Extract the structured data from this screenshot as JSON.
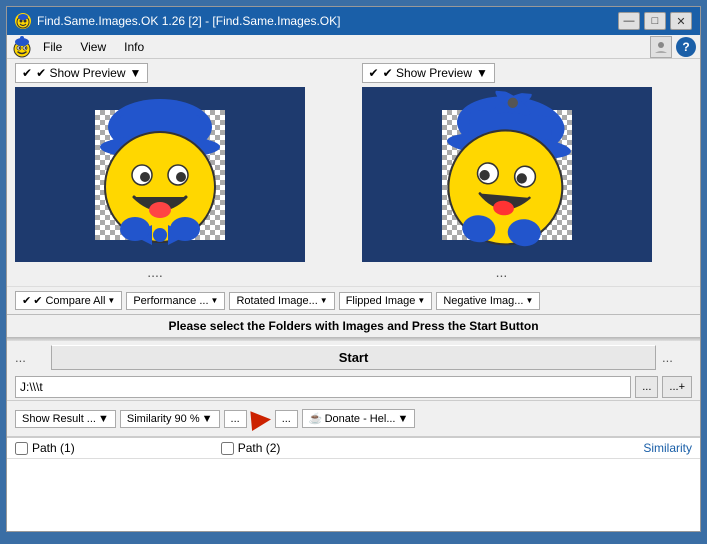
{
  "window": {
    "title": "Find.Same.Images.OK 1.26 [2] - [Find.Same.Images.OK]",
    "icon": "🙂"
  },
  "titlebar": {
    "minimize": "—",
    "maximize": "□",
    "close": "✕"
  },
  "menubar": {
    "items": [
      "File",
      "View",
      "Info"
    ]
  },
  "preview": {
    "left_label": "✔ Show Preview",
    "right_label": "✔ Show Preview",
    "left_dots": "....",
    "right_dots": "...",
    "flipped_image_label": "Flipped Image"
  },
  "controls": {
    "compare_all": "✔ Compare All",
    "performance": "Performance ...",
    "rotated_image": "Rotated Image...",
    "flipped_image": "Flipped Image",
    "negative_image": "Negative Imag..."
  },
  "status": {
    "message": "Please select the Folders with Images and Press the Start Button"
  },
  "start_row": {
    "left_dots": "...",
    "button": "Start",
    "right_dots": "..."
  },
  "path_row": {
    "value": "J:\\\\\\t",
    "browse": "...",
    "browse_add": "...+"
  },
  "bottom_toolbar": {
    "show_result": "Show Result ...",
    "similarity": "Similarity 90 %",
    "dots": "...",
    "arrow_indicator": "▶",
    "dots2": "...",
    "donate": "Donate - Hel...",
    "donate_icon": "☕"
  },
  "results": {
    "path1_label": "Path (1)",
    "path2_label": "Path (2)",
    "similarity_label": "Similarity",
    "path1_short": "Path",
    "path2_short": "Path"
  }
}
